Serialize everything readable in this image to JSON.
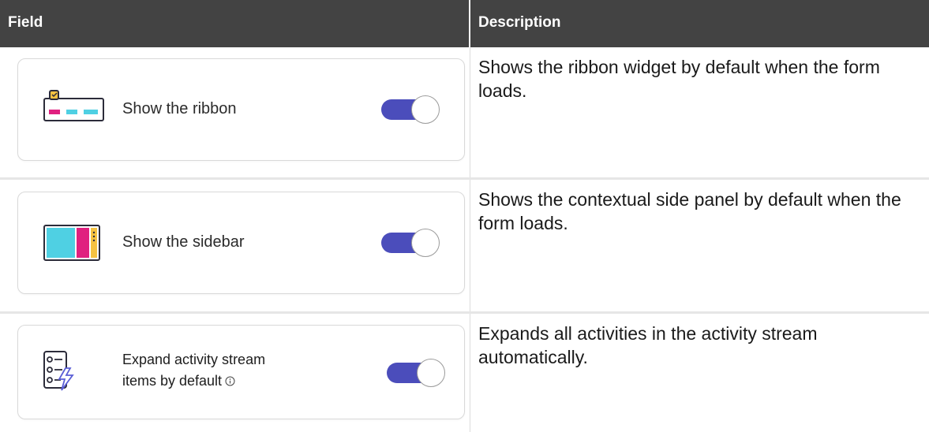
{
  "header": {
    "col_field": "Field",
    "col_description": "Description"
  },
  "colors": {
    "header_bg": "#434343",
    "toggle_on": "#4b4dbb"
  },
  "rows": [
    {
      "label": "Show the ribbon",
      "icon": "ribbon-icon",
      "toggle_on": true,
      "description": "Shows the ribbon widget by default when the form loads."
    },
    {
      "label": "Show the sidebar",
      "icon": "sidebar-icon",
      "toggle_on": true,
      "description": "Shows the contextual side panel by default when the form loads."
    },
    {
      "label_line1": "Expand activity stream",
      "label_line2": "items by default",
      "icon": "activity-stream-icon",
      "info_icon": "info-icon",
      "toggle_on": true,
      "description": "Expands all activities in the activity stream automatically."
    }
  ]
}
